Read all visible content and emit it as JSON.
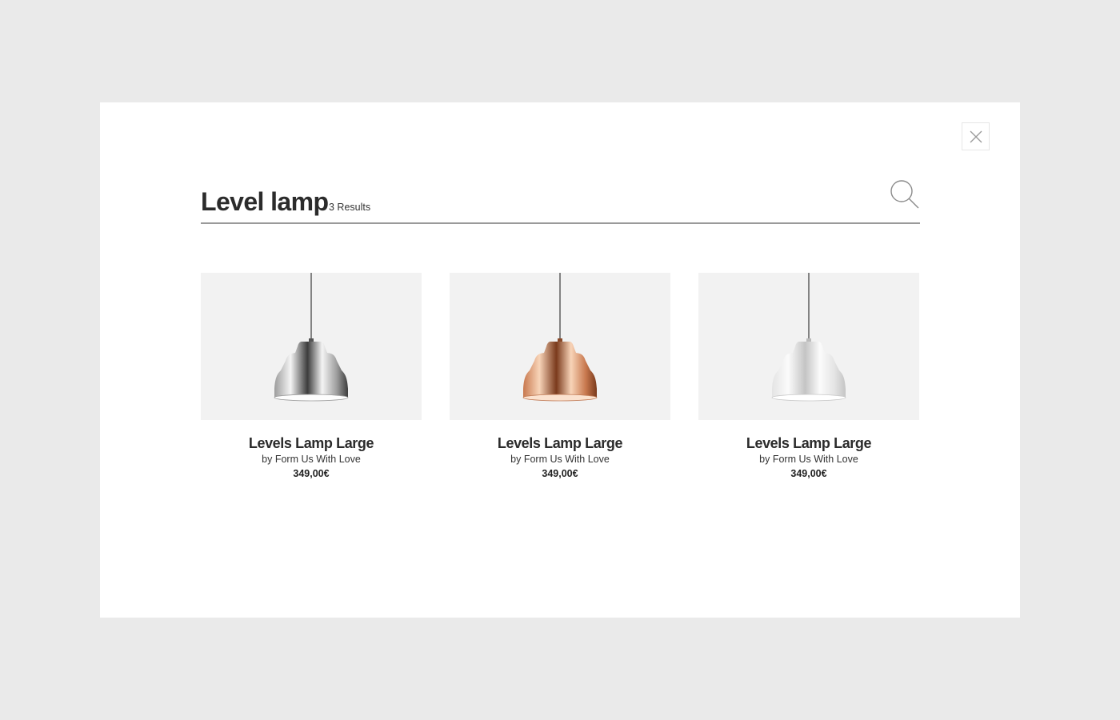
{
  "search": {
    "query": "Level lamp",
    "results_label": "3 Results"
  },
  "icons": {
    "close": "close-icon",
    "search": "search-icon"
  },
  "products": [
    {
      "name": "Levels Lamp Large",
      "brand": "by Form Us With Love",
      "price": "349,00€",
      "finish": "chrome",
      "shade_light": "#f4f4f4",
      "shade_mid": "#9c9c9c",
      "shade_dark": "#3c3c3c"
    },
    {
      "name": "Levels Lamp Large",
      "brand": "by Form Us With Love",
      "price": "349,00€",
      "finish": "copper",
      "shade_light": "#f8d4b8",
      "shade_mid": "#c8784e",
      "shade_dark": "#7a3a1c"
    },
    {
      "name": "Levels Lamp Large",
      "brand": "by Form Us With Love",
      "price": "349,00€",
      "finish": "white",
      "shade_light": "#fbfbfb",
      "shade_mid": "#e4e4e4",
      "shade_dark": "#c4c4c4"
    }
  ]
}
